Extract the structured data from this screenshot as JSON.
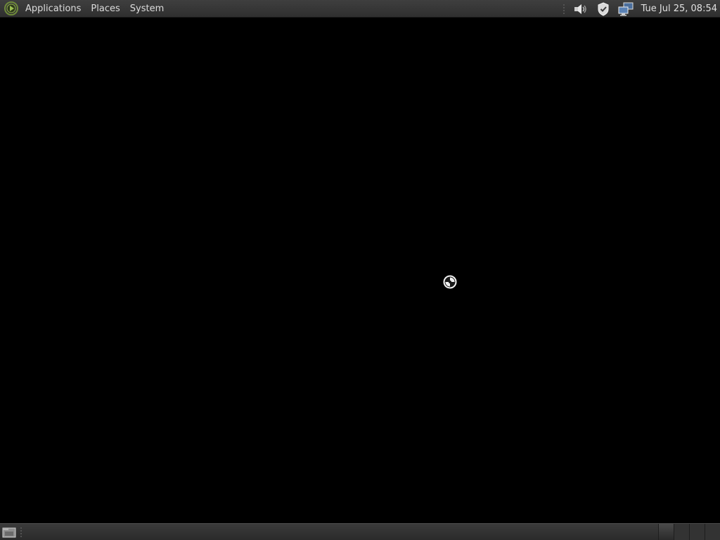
{
  "top_panel": {
    "menus": [
      {
        "label": "Applications"
      },
      {
        "label": "Places"
      },
      {
        "label": "System"
      }
    ],
    "tray_icons": [
      "volume-icon",
      "shield-icon",
      "network-icon"
    ],
    "clock": "Tue Jul 25, 08:54"
  },
  "bottom_panel": {
    "show_desktop_icon": "show-desktop-icon",
    "workspaces": [
      {
        "active": true
      },
      {
        "active": false
      },
      {
        "active": false
      },
      {
        "active": false
      }
    ]
  },
  "colors": {
    "desktop_background": "#000000",
    "panel": "#333333",
    "panel_text": "#dcdcdc",
    "logo_green": "#7a9a3a"
  }
}
